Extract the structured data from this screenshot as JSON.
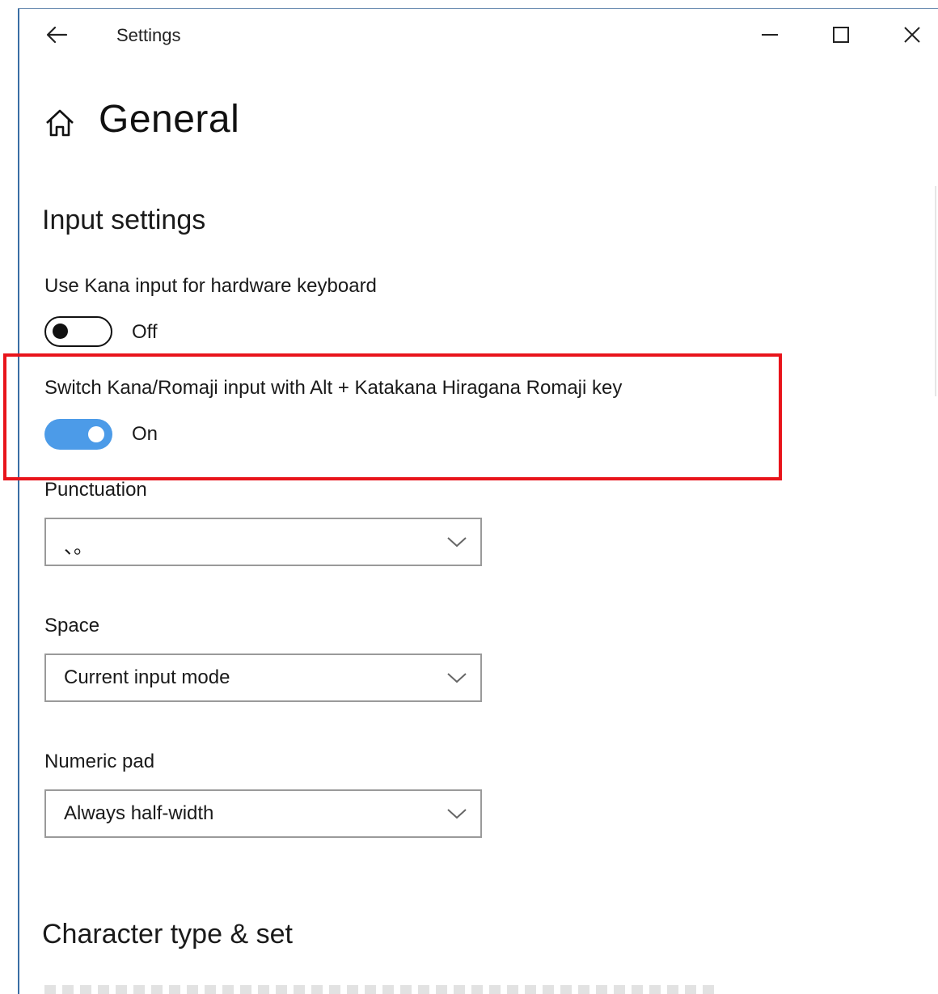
{
  "window": {
    "title": "Settings",
    "controls": {
      "minimize_icon": "minimize-icon",
      "maximize_icon": "maximize-icon",
      "close_icon": "close-icon"
    },
    "back_icon": "back-arrow-icon"
  },
  "page": {
    "home_icon": "home-icon",
    "title": "General"
  },
  "input_settings": {
    "heading": "Input settings",
    "kana_input": {
      "label": "Use Kana input for hardware keyboard",
      "state": "Off",
      "enabled": false
    },
    "switch_kana_romaji": {
      "label": "Switch Kana/Romaji input with Alt + Katakana Hiragana Romaji key",
      "state": "On",
      "enabled": true,
      "highlighted": true,
      "highlight_color": "#e8141b"
    },
    "punctuation": {
      "label": "Punctuation",
      "value": "、。"
    },
    "space": {
      "label": "Space",
      "value": "Current input mode"
    },
    "numeric_pad": {
      "label": "Numeric pad",
      "value": "Always half-width"
    }
  },
  "character_type": {
    "heading": "Character type & set"
  },
  "colors": {
    "toggle_on": "#4c9be8",
    "toggle_off_border": "#111111",
    "dropdown_border": "#9a9a9a",
    "window_border": "#3a6ea5"
  }
}
